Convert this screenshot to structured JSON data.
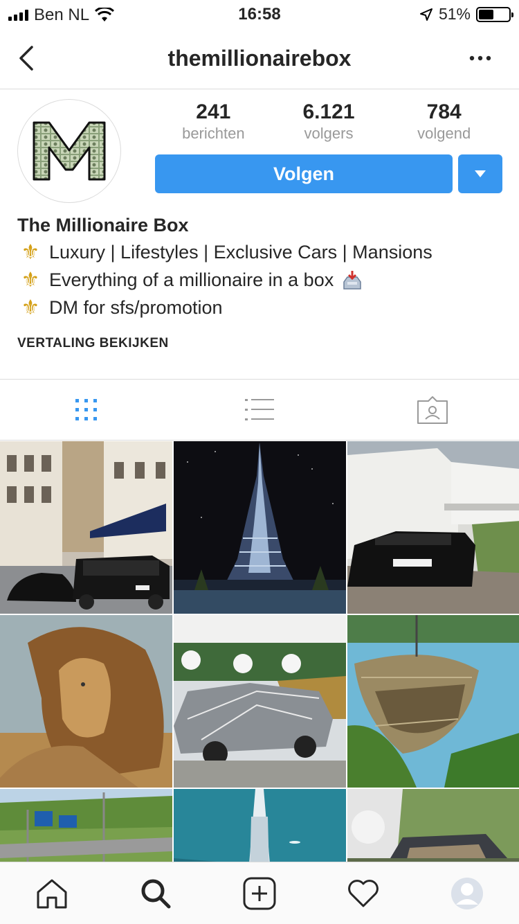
{
  "status_bar": {
    "carrier": "Ben NL",
    "time": "16:58",
    "battery_percent": "51%",
    "battery_level": 0.51
  },
  "nav": {
    "title": "themillionairebox",
    "back_icon": "chevron-left-icon",
    "more_icon": "more-horizontal-icon"
  },
  "profile": {
    "avatar_icon": "millionaire-box-logo",
    "stats": [
      {
        "count": "241",
        "label": "berichten"
      },
      {
        "count": "6.121",
        "label": "volgers"
      },
      {
        "count": "784",
        "label": "volgend"
      }
    ],
    "follow_label": "Volgen",
    "accent_color": "#3897f0"
  },
  "bio": {
    "name": "The Millionaire Box",
    "lines": [
      "Luxury | Lifestyles | Exclusive Cars | Mansions",
      "Everything of a millionaire in a box",
      "DM for sfs/promotion"
    ],
    "bullet_glyph": "⚜",
    "translate_label": "VERTALING BEKIJKEN"
  },
  "tabs": [
    {
      "icon": "grid-icon",
      "active": true
    },
    {
      "icon": "list-icon",
      "active": false
    },
    {
      "icon": "tagged-icon",
      "active": false
    }
  ],
  "grid_posts": [
    "street-black-supercars",
    "burj-khalifa-night",
    "white-villa-lamborghini",
    "lion-portrait",
    "chrome-lamborghini",
    "hanging-nest-seat",
    "highway-signs",
    "burj-al-arab-aerial",
    "convertible-garden"
  ],
  "bottom_bar": [
    {
      "icon": "home-icon"
    },
    {
      "icon": "search-icon"
    },
    {
      "icon": "add-post-icon"
    },
    {
      "icon": "heart-icon"
    },
    {
      "icon": "profile-avatar-icon"
    }
  ]
}
